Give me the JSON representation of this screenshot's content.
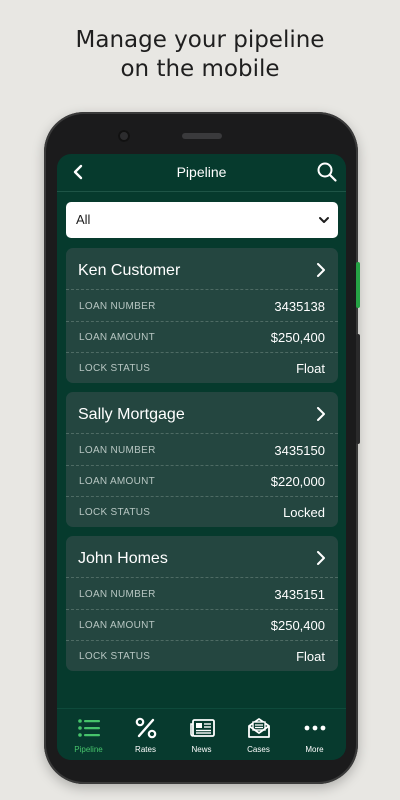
{
  "headline": {
    "line1": "Manage your pipeline",
    "line2": "on the mobile"
  },
  "app": {
    "title": "Pipeline",
    "filter": {
      "selected": "All"
    },
    "labels": {
      "loan_number": "LOAN NUMBER",
      "loan_amount": "LOAN AMOUNT",
      "lock_status": "LOCK STATUS"
    },
    "loans": [
      {
        "name": "Ken Customer",
        "loan_number": "3435138",
        "loan_amount": "$250,400",
        "lock_status": "Float"
      },
      {
        "name": "Sally Mortgage",
        "loan_number": "3435150",
        "loan_amount": "$220,000",
        "lock_status": "Locked"
      },
      {
        "name": "John Homes",
        "loan_number": "3435151",
        "loan_amount": "$250,400",
        "lock_status": "Float"
      }
    ],
    "tabs": [
      {
        "label": "Pipeline",
        "icon": "list-icon",
        "active": true
      },
      {
        "label": "Rates",
        "icon": "percent-icon"
      },
      {
        "label": "News",
        "icon": "newspaper-icon"
      },
      {
        "label": "Cases",
        "icon": "envelope-icon"
      },
      {
        "label": "More",
        "icon": "more-dots-icon"
      }
    ]
  },
  "colors": {
    "screen_bg": "#063a2d",
    "card_bg": "#244640",
    "accent": "#46c36b"
  }
}
